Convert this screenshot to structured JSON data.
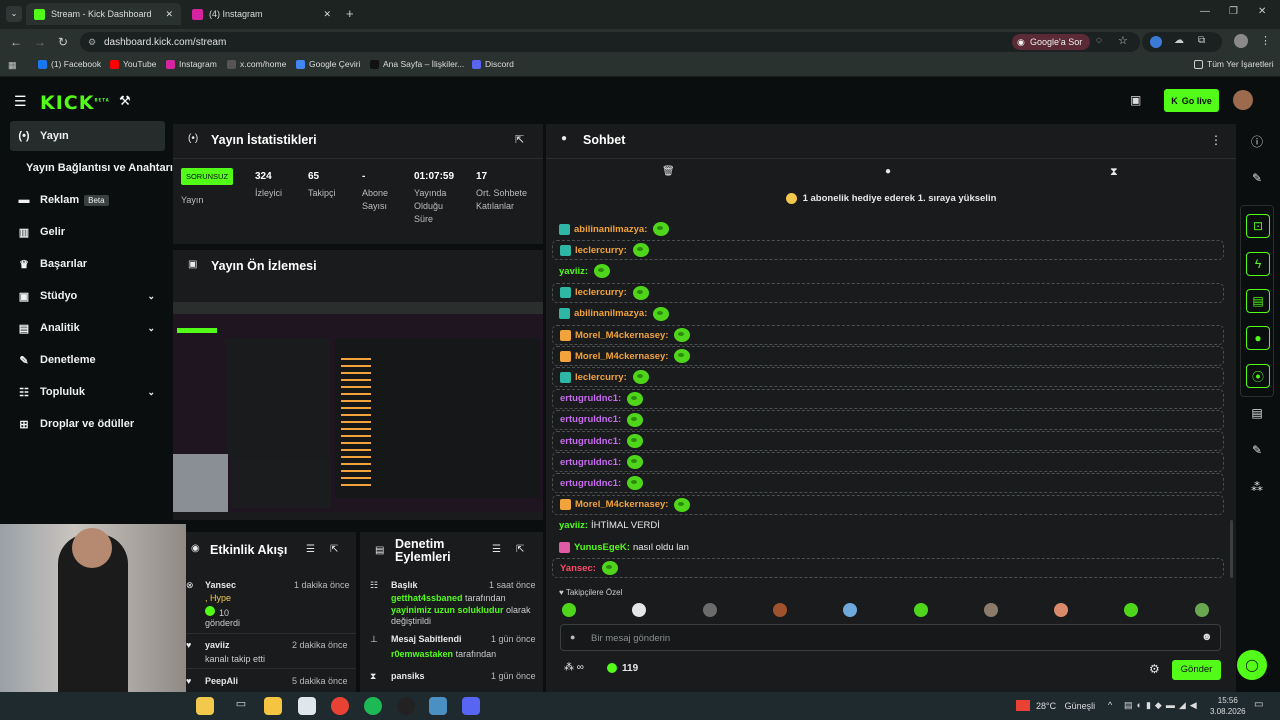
{
  "browser": {
    "tabs": [
      {
        "label": "Stream - Kick Dashboard"
      },
      {
        "label": "(4) Instagram"
      }
    ],
    "url": "dashboard.kick.com/stream",
    "google_btn": "Google'a Sor",
    "bookmarks": [
      "(1) Facebook",
      "YouTube",
      "Instagram",
      "x.com/home",
      "Google Çeviri",
      "Ana Sayfa – İlişkiler...",
      "Discord"
    ],
    "all_bookmarks": "Tüm Yer İşaretleri"
  },
  "header": {
    "logo": "KICK",
    "beta_sup": "BETA",
    "go_live": "Go live"
  },
  "sidebar": {
    "items": [
      {
        "label": "Yayın",
        "icon": "broadcast-icon"
      },
      {
        "label": "Yayın Bağlantısı ve Anahtarı"
      },
      {
        "label": "Reklam",
        "badge": "Beta"
      },
      {
        "label": "Gelir"
      },
      {
        "label": "Başarılar"
      },
      {
        "label": "Stüdyo"
      },
      {
        "label": "Analitik"
      },
      {
        "label": "Denetleme"
      },
      {
        "label": "Topluluk"
      },
      {
        "label": "Droplar ve ödüller"
      }
    ]
  },
  "stats": {
    "title": "Yayın İstatistikleri",
    "status": "SORUNSUZ",
    "status_label": "Yayın",
    "items": [
      {
        "value": "324",
        "label": "İzleyici"
      },
      {
        "value": "65",
        "label": "Takipçi"
      },
      {
        "value": "-",
        "label": "Abone Sayısı"
      },
      {
        "value": "01:07:59",
        "label": "Yayında Olduğu Süre"
      },
      {
        "value": "17",
        "label": "Ort. Sohbete Katılanlar"
      }
    ]
  },
  "preview": {
    "title": "Yayın Ön İzlemesi"
  },
  "activity": {
    "title": "Etkinlik Akışı",
    "items": [
      {
        "user": "Yansec",
        "time": "1 dakika önce",
        "line1": ", Hype",
        "line2": "10",
        "line3": "gönderdi"
      },
      {
        "user": "yaviiz",
        "time": "2 dakika önce",
        "line1": "kanalı takip etti"
      },
      {
        "user": "PeepAli",
        "time": "5 dakika önce"
      }
    ]
  },
  "moderation": {
    "title": "Denetim Eylemleri",
    "items": [
      {
        "title": "Başlık",
        "time": "1 saat önce",
        "user": "getthat4ssbaned",
        "suffix": "tarafından",
        "text": "yayinimiz uzun solukludur",
        "text2": "olarak değiştirildi"
      },
      {
        "title": "Mesaj Sabitlendi",
        "time": "1 gün önce",
        "user": "r0emwastaken",
        "suffix": "tarafından"
      },
      {
        "title": "pansiks",
        "time": "1 gün önce"
      }
    ]
  },
  "chat": {
    "title": "Sohbet",
    "banner": "1 abonelik hediye ederek 1. sıraya yükselin",
    "messages": [
      {
        "user": "abilinanilmazya:",
        "color": "#f2a33b",
        "badge": "36",
        "boxed": false
      },
      {
        "user": "leclercurry:",
        "color": "#f2a33b",
        "badge": "sub",
        "boxed": true
      },
      {
        "user": "yaviiz:",
        "color": "#53fc18",
        "boxed": false
      },
      {
        "user": "leclercurry:",
        "color": "#f2a33b",
        "badge": "sub",
        "boxed": true
      },
      {
        "user": "abilinanilmazya:",
        "color": "#f2a33b",
        "badge": "36",
        "boxed": false
      },
      {
        "user": "Morel_M4ckernasey:",
        "color": "#f2a33b",
        "badge": "crown",
        "boxed": true
      },
      {
        "user": "Morel_M4ckernasey:",
        "color": "#f2a33b",
        "badge": "crown",
        "boxed": true
      },
      {
        "user": "leclercurry:",
        "color": "#f2a33b",
        "badge": "sub",
        "boxed": true
      },
      {
        "user": "ertugruldnc1:",
        "color": "#c86cf0",
        "boxed": true
      },
      {
        "user": "ertugruldnc1:",
        "color": "#c86cf0",
        "boxed": true
      },
      {
        "user": "ertugruldnc1:",
        "color": "#c86cf0",
        "boxed": true
      },
      {
        "user": "ertugruldnc1:",
        "color": "#c86cf0",
        "boxed": true
      },
      {
        "user": "ertugruldnc1:",
        "color": "#c86cf0",
        "boxed": true
      },
      {
        "user": "Morel_M4ckernasey:",
        "color": "#f2a33b",
        "badge": "crown",
        "boxed": true
      },
      {
        "user": "yaviiz:",
        "color": "#53fc18",
        "text": "İHTİMAL VERDİ",
        "boxed": false
      },
      {
        "user": "YunusEgeK:",
        "color": "#53fc18",
        "badge": "24",
        "text": "nasıl oldu lan",
        "boxed": false
      },
      {
        "user": "Yansec:",
        "color": "#ff4a6a",
        "boxed": true
      }
    ],
    "followers_only": "Takipçilere Özel",
    "input_placeholder": "Bir mesaj gönderin",
    "infinity": "∞",
    "points": "119",
    "send": "Gönder"
  },
  "taskbar": {
    "weather": "28°C",
    "weather_desc": "Güneşli",
    "time": "15:56",
    "date": "3.08.2026"
  },
  "colors": {
    "accent": "#53fc18",
    "bg": "#0b0e0f",
    "panel": "#191b1c"
  }
}
